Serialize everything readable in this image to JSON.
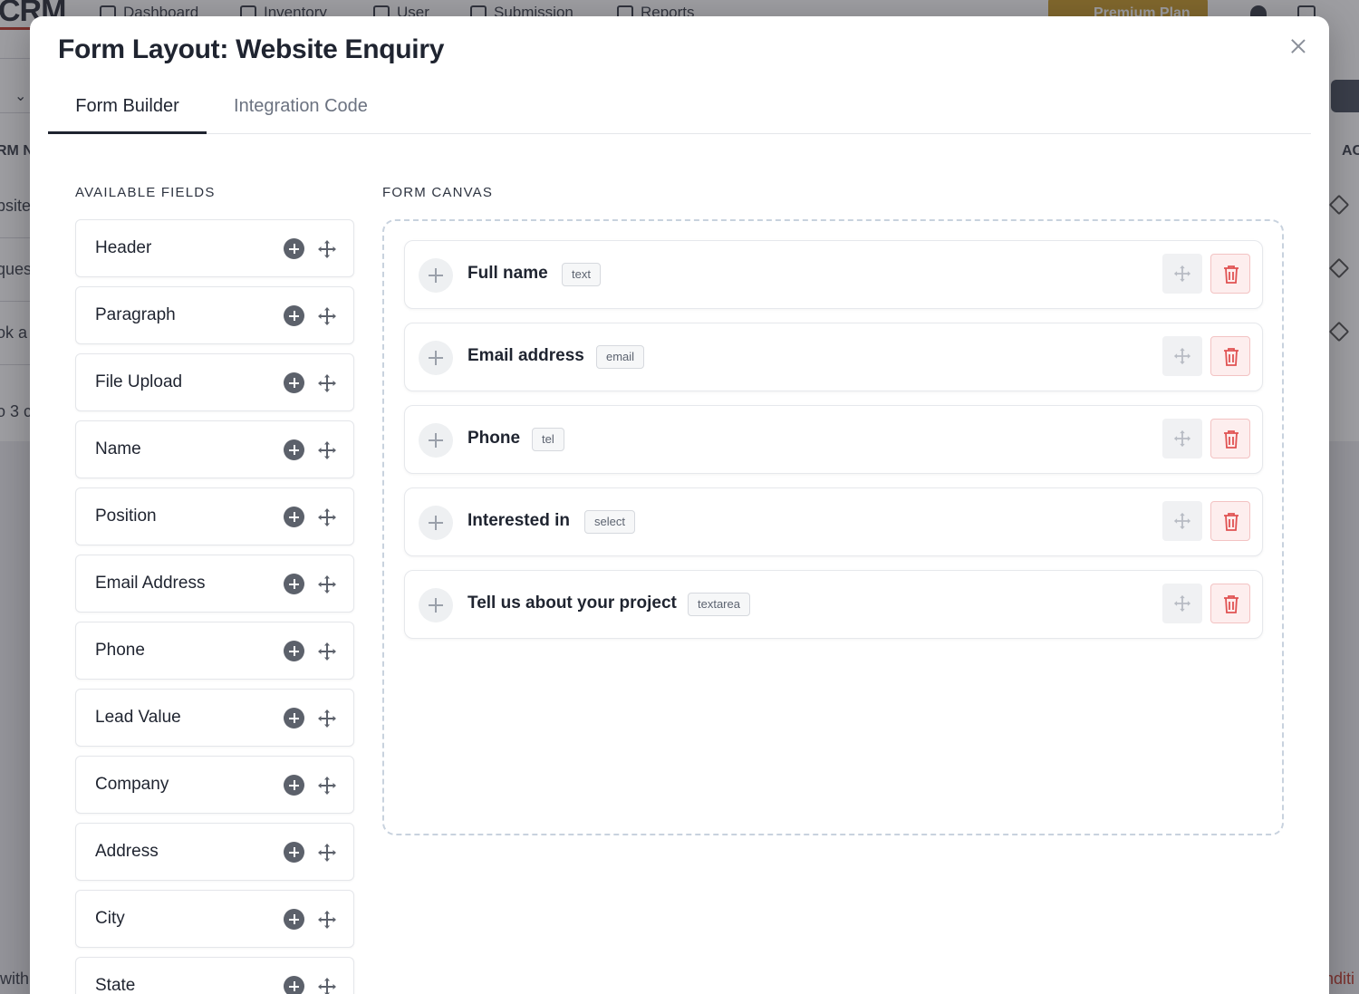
{
  "background": {
    "logo": "CRM",
    "nav": [
      "Dashboard",
      "Inventory",
      "User",
      "Submission",
      "Reports"
    ],
    "premium_label": "Premium Plan",
    "left_fragments": [
      "RM N",
      "bsite",
      "ques",
      "ok a",
      "o 3 c",
      "with"
    ],
    "right_fragments": [
      "AC",
      "nditi"
    ]
  },
  "modal": {
    "title": "Form Layout: Website Enquiry",
    "tabs": [
      {
        "label": "Form Builder",
        "active": true
      },
      {
        "label": "Integration Code",
        "active": false
      }
    ]
  },
  "available_fields": {
    "heading": "AVAILABLE FIELDS",
    "items": [
      "Header",
      "Paragraph",
      "File Upload",
      "Name",
      "Position",
      "Email Address",
      "Phone",
      "Lead Value",
      "Company",
      "Address",
      "City",
      "State"
    ]
  },
  "form_canvas": {
    "heading": "FORM CANVAS",
    "rows": [
      {
        "label": "Full name",
        "type": "text"
      },
      {
        "label": "Email address",
        "type": "email"
      },
      {
        "label": "Phone",
        "type": "tel"
      },
      {
        "label": "Interested in",
        "type": "select"
      },
      {
        "label": "Tell us about your project",
        "type": "textarea"
      }
    ]
  },
  "colors": {
    "accent": "#1f2430",
    "delete": "#e05252",
    "premium": "#c89b2a"
  }
}
